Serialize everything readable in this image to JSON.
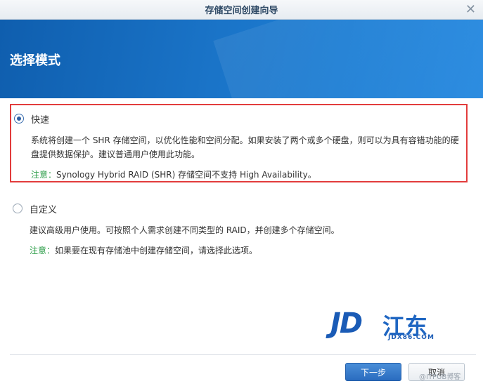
{
  "window": {
    "title": "存储空间创建向导",
    "close_icon": "close-icon"
  },
  "banner": {
    "title": "选择模式"
  },
  "options": [
    {
      "label": "快速",
      "selected": true,
      "description": "系统将创建一个 SHR 存储空间，以优化性能和空间分配。如果安装了两个或多个硬盘，则可以为具有容错功能的硬盘提供数据保护。建议普通用户使用此功能。",
      "note_label": "注意：",
      "note_text": "Synology Hybrid RAID (SHR) 存储空间不支持 High Availability。"
    },
    {
      "label": "自定义",
      "selected": false,
      "description": "建议高级用户使用。可按照个人需求创建不同类型的 RAID，并创建多个存储空间。",
      "note_label": "注意：",
      "note_text": "如果要在现有存储池中创建存储空间，请选择此选项。"
    }
  ],
  "logo": {
    "mark": "JD",
    "name": "江东",
    "sub": "JDX86.COM"
  },
  "footer": {
    "next_label": "下一步",
    "cancel_label": "取消"
  },
  "watermark": "@ITPUB博客",
  "colors": {
    "banner": "#1a74c8",
    "highlight_border": "#e23c3c",
    "note_green": "#2e9e4a",
    "primary_button": "#2a6cc0"
  }
}
